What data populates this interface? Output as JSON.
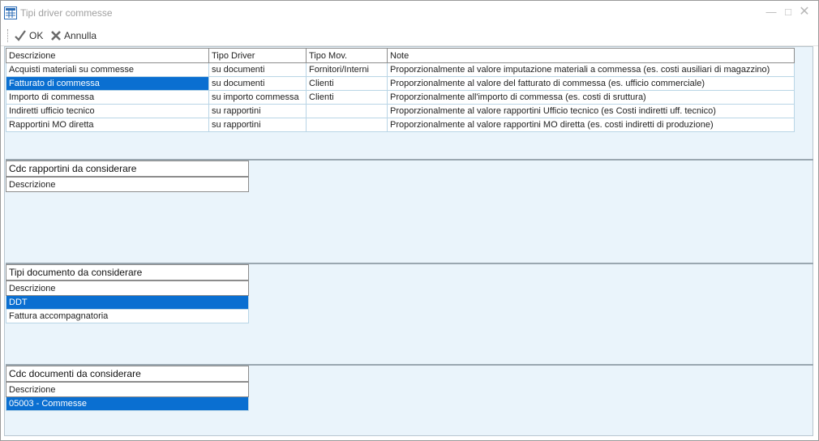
{
  "window": {
    "title": "Tipi driver commesse",
    "app_icon": "grid-app-icon",
    "controls": {
      "minimize": "minimize-icon",
      "maximize": "maximize-icon",
      "close": "close-icon"
    }
  },
  "toolbar": {
    "ok_label": "OK",
    "cancel_label": "Annulla",
    "ok_icon": "checkmark-icon",
    "cancel_icon": "x-cross-icon"
  },
  "drivers": {
    "headers": [
      "Descrizione",
      "Tipo Driver",
      "Tipo Mov.",
      "Note"
    ],
    "rows": [
      [
        "Acquisti materiali su commesse",
        "su documenti",
        "Fornitori/Interni",
        "Proporzionalmente al valore imputazione materiali a commessa (es. costi ausiliari di magazzino)"
      ],
      [
        "Fatturato di commessa",
        "su documenti",
        "Clienti",
        "Proporzionalmente al valore del fatturato di commessa (es. ufficio commerciale)"
      ],
      [
        "Importo di commessa",
        "su importo commessa",
        "Clienti",
        "Proporzionalmente all'importo di commessa (es. costi di sruttura)"
      ],
      [
        "Indiretti ufficio tecnico",
        "su rapportini",
        "",
        "Proporzionalmente al valore rapportini Ufficio tecnico (es Costi indiretti uff. tecnico)"
      ],
      [
        "Rapportini MO diretta",
        "su rapportini",
        "",
        "Proporzionalmente al valore rapportini MO diretta (es. costi indiretti di produzione)"
      ]
    ],
    "selected_row": 1
  },
  "cdc_rapportini": {
    "title": "Cdc rapportini da considerare",
    "header": "Descrizione",
    "rows": []
  },
  "tipi_documento": {
    "title": "Tipi documento da considerare",
    "header": "Descrizione",
    "rows": [
      "DDT",
      "Fattura accompagnatoria"
    ],
    "selected_row": 0
  },
  "cdc_documenti": {
    "title": "Cdc documenti da considerare",
    "header": "Descrizione",
    "rows": [
      "05003 - Commesse"
    ],
    "selected_row": 0
  },
  "colors": {
    "selection": "#0a6fd1",
    "panel_background": "#eaf4fb",
    "row_border": "#b9d5e6"
  }
}
